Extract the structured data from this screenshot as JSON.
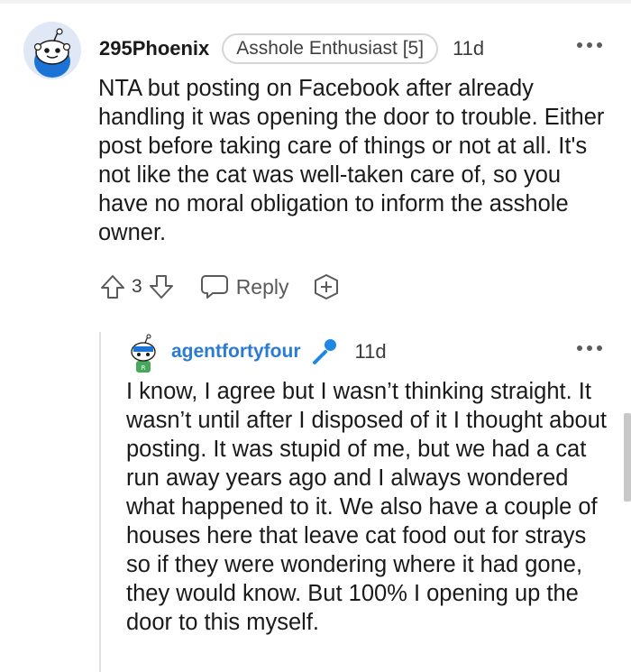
{
  "comment1": {
    "username": "295Phoenix",
    "flair": "Asshole Enthusiast [5]",
    "time": "11d",
    "body": "NTA but posting on Facebook after already handling it was opening the door to trouble. Either post before taking care of things or not at all. It's not like the cat was well-taken care of, so you have no moral obligation to inform the asshole owner.",
    "vote_count": "3",
    "reply_label": "Reply"
  },
  "comment2": {
    "username": "agentfortyfour",
    "time": "11d",
    "body": "I know, I agree but I wasn’t thinking straight. It wasn’t until after I disposed of it I thought about posting. It was stupid of me, but we had a cat run away years ago and I always wondered what happened to it. We also have a couple of houses here that leave cat food out for strays so if they were wondering where it had gone, they would know. But 100% I opening up the door to this myself."
  },
  "colors": {
    "username_link": "#2a7bd4",
    "mic_icon": "#1e88e5",
    "text": "#1a1a1b"
  },
  "icons": [
    "snoo-avatar-icon",
    "more-options-icon",
    "upvote-icon",
    "downvote-icon",
    "reply-icon",
    "award-icon",
    "microphone-icon"
  ]
}
